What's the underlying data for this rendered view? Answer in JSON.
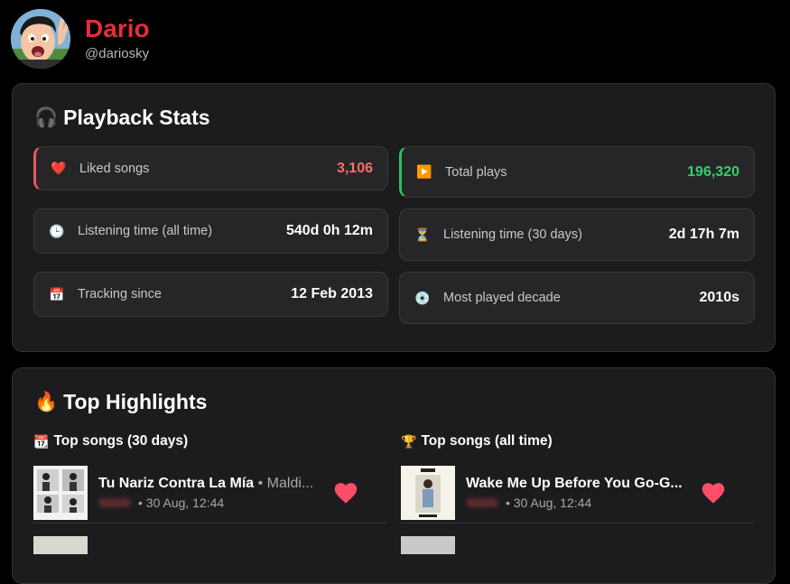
{
  "profile": {
    "name": "Dario",
    "handle": "@dariosky"
  },
  "stats": {
    "title": "Playback Stats",
    "items": [
      {
        "id": "liked",
        "icon": "heart-icon",
        "emoji": "❤️",
        "label": "Liked songs",
        "value": "3,106"
      },
      {
        "id": "plays",
        "icon": "play-icon",
        "emoji": "▶️",
        "label": "Total plays",
        "value": "196,320"
      },
      {
        "id": "time_all",
        "icon": "clock-icon",
        "emoji": "🕒",
        "label": "Listening time (all time)",
        "value": "540d 0h 12m"
      },
      {
        "id": "time_30",
        "icon": "hourglass-icon",
        "emoji": "⏳",
        "label": "Listening time (30 days)",
        "value": "2d 17h 7m"
      },
      {
        "id": "tracking",
        "icon": "calendar-icon",
        "emoji": "📅",
        "label": "Tracking since",
        "value": "12 Feb 2013"
      },
      {
        "id": "decade",
        "icon": "disc-icon",
        "emoji": "💿",
        "label": "Most played decade",
        "value": "2010s"
      }
    ]
  },
  "highlights": {
    "title": "Top Highlights",
    "columns": [
      {
        "title": "Top songs (30 days)",
        "emoji": "📆",
        "songs": [
          {
            "title": "Tu Nariz Contra La Mía",
            "artist": "Maldi...",
            "time": "30 Aug, 12:44"
          }
        ]
      },
      {
        "title": "Top songs (all time)",
        "emoji": "🏆",
        "songs": [
          {
            "title": "Wake Me Up Before You Go-G...",
            "artist": "",
            "time": "30 Aug, 12:44"
          }
        ]
      }
    ]
  },
  "colors": {
    "accent_red": "#e0303a",
    "liked_value": "#ff6b6b",
    "plays_value": "#33d16a",
    "panel_bg": "#1c1c1e"
  }
}
